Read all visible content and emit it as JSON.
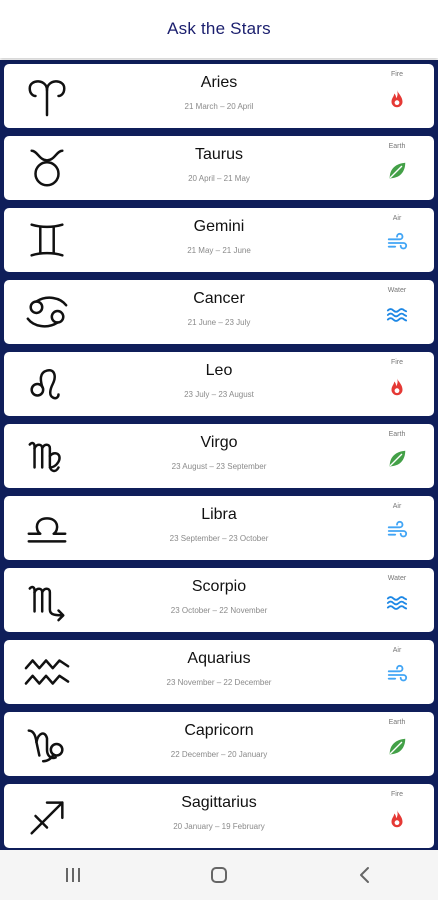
{
  "app_bar": {
    "title": "Ask the Stars"
  },
  "signs": [
    {
      "name": "Aries",
      "dates": "21 March – 20 April",
      "element": "Fire",
      "symbol": "aries-icon",
      "element_icon": "flame-icon",
      "element_color": "#e53935"
    },
    {
      "name": "Taurus",
      "dates": "20 April – 21 May",
      "element": "Earth",
      "symbol": "taurus-icon",
      "element_icon": "leaf-icon",
      "element_color": "#43a047"
    },
    {
      "name": "Gemini",
      "dates": "21 May – 21 June",
      "element": "Air",
      "symbol": "gemini-icon",
      "element_icon": "wind-icon",
      "element_color": "#42a5f5"
    },
    {
      "name": "Cancer",
      "dates": "21 June – 23 July",
      "element": "Water",
      "symbol": "cancer-icon",
      "element_icon": "waves-icon",
      "element_color": "#1e88e5"
    },
    {
      "name": "Leo",
      "dates": "23 July – 23 August",
      "element": "Fire",
      "symbol": "leo-icon",
      "element_icon": "flame-icon",
      "element_color": "#e53935"
    },
    {
      "name": "Virgo",
      "dates": "23 August – 23 September",
      "element": "Earth",
      "symbol": "virgo-icon",
      "element_icon": "leaf-icon",
      "element_color": "#43a047"
    },
    {
      "name": "Libra",
      "dates": "23 September – 23 October",
      "element": "Air",
      "symbol": "libra-icon",
      "element_icon": "wind-icon",
      "element_color": "#42a5f5"
    },
    {
      "name": "Scorpio",
      "dates": "23 October – 22 November",
      "element": "Water",
      "symbol": "scorpio-icon",
      "element_icon": "waves-icon",
      "element_color": "#1e88e5"
    },
    {
      "name": "Aquarius",
      "dates": "23 November – 22 December",
      "element": "Air",
      "symbol": "aquarius-icon",
      "element_icon": "wind-icon",
      "element_color": "#42a5f5"
    },
    {
      "name": "Capricorn",
      "dates": "22 December – 20 January",
      "element": "Earth",
      "symbol": "capricorn-icon",
      "element_icon": "leaf-icon",
      "element_color": "#43a047"
    },
    {
      "name": "Sagittarius",
      "dates": "20 January – 19 February",
      "element": "Fire",
      "symbol": "sagittarius-icon",
      "element_icon": "flame-icon",
      "element_color": "#e53935"
    }
  ],
  "nav_bar": {
    "icons": [
      "recent-apps-icon",
      "home-icon",
      "back-icon"
    ]
  }
}
